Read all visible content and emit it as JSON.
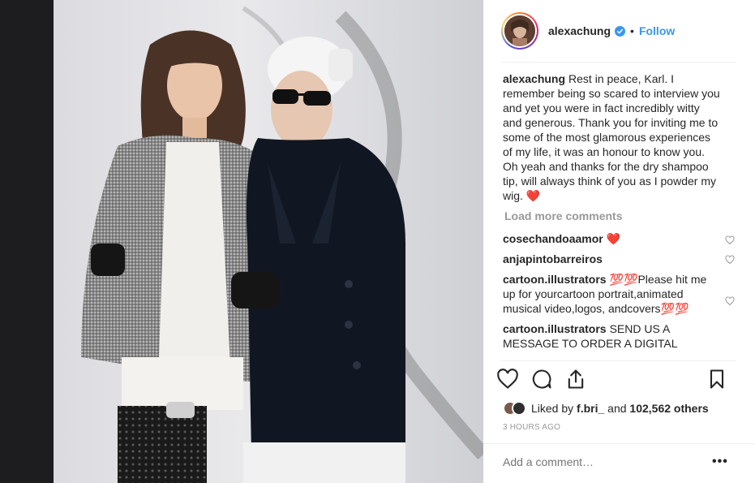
{
  "header": {
    "username": "alexachung",
    "separator": "•",
    "follow_label": "Follow"
  },
  "caption": {
    "username": "alexachung",
    "text": "Rest in peace, Karl. I remember being so scared to interview you and yet you were in fact incredibly witty and generous. Thank you for inviting me to some of the most glamorous experiences of my life, it was an honour to know you. Oh yeah and thanks for the dry shampoo tip, will always think of you as I powder my wig. ❤️"
  },
  "load_more_label": "Load more comments",
  "comments": [
    {
      "username": "cosechandoaamor",
      "text": "❤️"
    },
    {
      "username": "anjapintobarreiros",
      "text": ""
    },
    {
      "username": "cartoon.illustrators",
      "text": "💯💯Please hit me up for yourcartoon portrait,animated musical video,logos, andcovers💯💯"
    },
    {
      "username": "cartoon.illustrators",
      "text": "SEND US A MESSAGE TO ORDER A DIGITAL"
    }
  ],
  "likes": {
    "prefix": "Liked by",
    "first_user": "f.bri_",
    "conjunction": "and",
    "count": "102,562 others"
  },
  "timestamp": "3 HOURS AGO",
  "add_comment_placeholder": "Add a comment…",
  "more_label": "•••",
  "icons": {
    "like": "heart-outline-icon",
    "comment": "speech-bubble-icon",
    "share": "share-icon",
    "save": "bookmark-icon",
    "verified": "verified-badge-icon"
  },
  "colors": {
    "accent": "#3897f0",
    "text": "#262626",
    "muted": "#999999",
    "red_heart": "#ed4956"
  }
}
